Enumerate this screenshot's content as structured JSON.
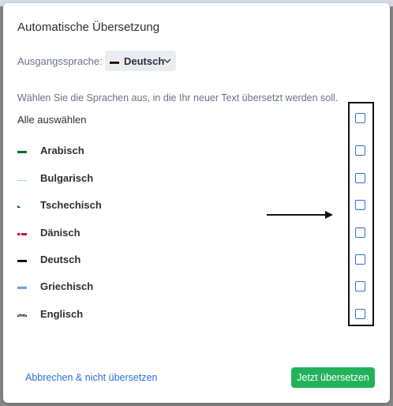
{
  "dialog": {
    "title": "Automatische Übersetzung",
    "source_label": "Ausgangssprache:",
    "source_value": "Deutsch",
    "source_flag_icon": "flag-de-icon",
    "instruction": "Wählen Sie die Sprachen aus, in die Ihr neuer Text übersetzt werden soll.",
    "select_all_label": "Alle auswählen",
    "languages": [
      {
        "label": "Arabisch",
        "flag": "flag-sa-icon",
        "checked": false
      },
      {
        "label": "Bulgarisch",
        "flag": "flag-bg-icon",
        "checked": false
      },
      {
        "label": "Tschechisch",
        "flag": "flag-cz-icon",
        "checked": false
      },
      {
        "label": "Dänisch",
        "flag": "flag-dk-icon",
        "checked": false
      },
      {
        "label": "Deutsch",
        "flag": "flag-de-icon",
        "checked": false
      },
      {
        "label": "Griechisch",
        "flag": "flag-gr-icon",
        "checked": false
      },
      {
        "label": "Englisch",
        "flag": "flag-gb-icon",
        "checked": false
      }
    ],
    "cancel_label": "Abbrechen & nicht übersetzen",
    "submit_label": "Jetzt übersetzen"
  },
  "colors": {
    "accent": "#2f6fd6",
    "primary_button": "#22b35a",
    "text": "#2b2f36",
    "muted_text": "#6b7280"
  }
}
